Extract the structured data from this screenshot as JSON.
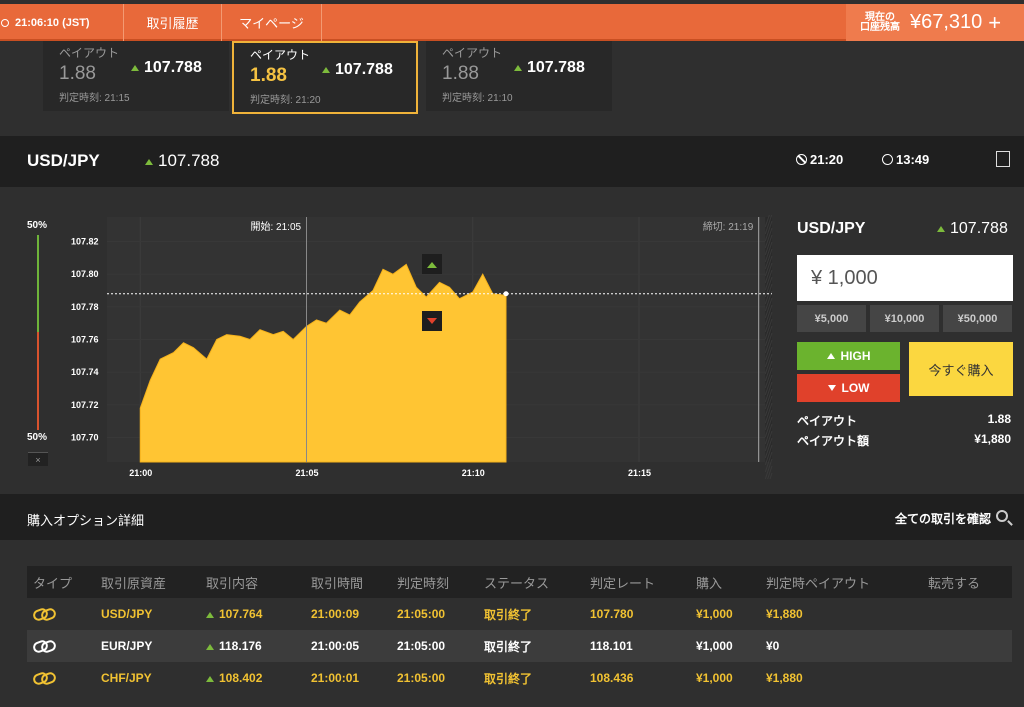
{
  "topbar": {
    "time": "21:06:10 (JST)",
    "nav": [
      "取引履歴",
      "マイページ"
    ],
    "balance_label_1": "現在の",
    "balance_label_2": "口座残高",
    "balance": "¥67,310",
    "plus": "+"
  },
  "cards": [
    {
      "label": "ペイアウト",
      "payout": "1.88",
      "rate": "107.788",
      "time": "判定時刻: 21:15"
    },
    {
      "label": "ペイアウト",
      "payout": "1.88",
      "rate": "107.788",
      "time": "判定時刻: 21:20"
    },
    {
      "label": "ペイアウト",
      "payout": "1.88",
      "rate": "107.788",
      "time": "判定時刻: 21:10"
    }
  ],
  "pairbar": {
    "pair": "USD/JPY",
    "rate": "107.788",
    "expiry": "21:20",
    "remaining": "13:49"
  },
  "sentiment": {
    "top": "50%",
    "bottom": "50%",
    "close": "×"
  },
  "chart_data": {
    "type": "area",
    "start_label": "開始: 21:05",
    "end_label": "締切: 21:19",
    "yticks": [
      "107.82",
      "107.80",
      "107.78",
      "107.76",
      "107.74",
      "107.72",
      "107.70"
    ],
    "xticks": [
      "21:00",
      "21:05",
      "21:10",
      "21:15"
    ],
    "ylim": [
      107.685,
      107.835
    ],
    "current_rate": 107.788,
    "x": [
      0,
      0.3,
      0.6,
      1,
      1.3,
      1.6,
      2,
      2.3,
      2.6,
      3,
      3.3,
      3.6,
      4,
      4.3,
      4.6,
      5,
      5.3,
      5.6,
      6,
      6.3,
      6.6,
      7,
      7.3,
      7.6,
      8,
      8.3,
      8.6,
      9,
      9.3,
      9.6,
      10,
      10.3,
      10.6,
      11
    ],
    "values": [
      107.718,
      107.735,
      107.748,
      107.752,
      107.758,
      107.755,
      107.748,
      107.76,
      107.763,
      107.762,
      107.76,
      107.766,
      107.763,
      107.765,
      107.76,
      107.768,
      107.772,
      107.77,
      107.778,
      107.775,
      107.783,
      107.79,
      107.803,
      107.8,
      107.806,
      107.792,
      107.786,
      107.795,
      107.792,
      107.785,
      107.789,
      107.8,
      107.788,
      107.787
    ]
  },
  "panel": {
    "pair": "USD/JPY",
    "rate": "107.788",
    "amount": "¥ 1,000",
    "quick": [
      "¥5,000",
      "¥10,000",
      "¥50,000"
    ],
    "high": "HIGH",
    "low": "LOW",
    "buy": "今すぐ購入",
    "payout_label": "ペイアウト",
    "payout_value": "1.88",
    "payout_amount_label": "ペイアウト額",
    "payout_amount_value": "¥1,880"
  },
  "details": {
    "title": "購入オプション詳細",
    "view_all": "全ての取引を確認",
    "headers": [
      "タイプ",
      "取引原資産",
      "取引内容",
      "取引時間",
      "判定時刻",
      "ステータス",
      "判定レート",
      "購入",
      "判定時ペイアウト",
      "転売する"
    ],
    "rows": [
      {
        "asset": "USD/JPY",
        "content": "107.764",
        "time": "21:00:09",
        "judge": "21:05:00",
        "status": "取引終了",
        "rate": "107.780",
        "buy": "¥1,000",
        "payout": "¥1,880"
      },
      {
        "asset": "EUR/JPY",
        "content": "118.176",
        "time": "21:00:05",
        "judge": "21:05:00",
        "status": "取引終了",
        "rate": "118.101",
        "buy": "¥1,000",
        "payout": "¥0"
      },
      {
        "asset": "CHF/JPY",
        "content": "108.402",
        "time": "21:00:01",
        "judge": "21:05:00",
        "status": "取引終了",
        "rate": "108.436",
        "buy": "¥1,000",
        "payout": "¥1,880"
      }
    ]
  }
}
